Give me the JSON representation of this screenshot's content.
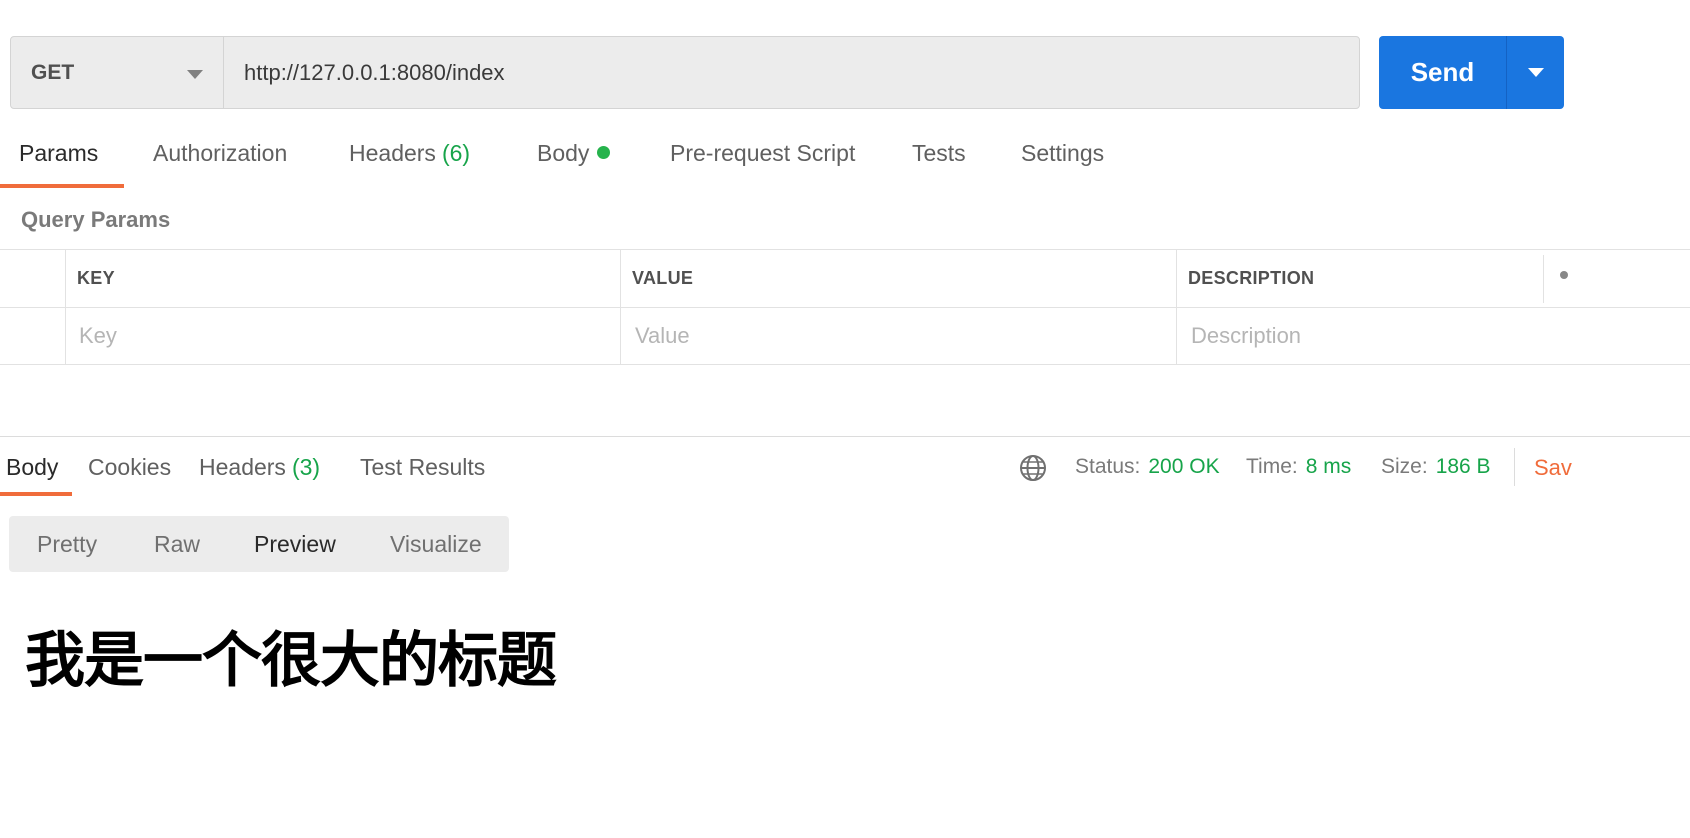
{
  "request": {
    "method": "GET",
    "url": "http://127.0.0.1:8080/index",
    "send_label": "Send"
  },
  "request_tabs": {
    "params": "Params",
    "authorization": "Authorization",
    "headers": "Headers",
    "headers_count": "(6)",
    "body": "Body",
    "pre_request_script": "Pre-request Script",
    "tests": "Tests",
    "settings": "Settings"
  },
  "query_params": {
    "title": "Query Params",
    "columns": {
      "key": "KEY",
      "value": "VALUE",
      "description": "DESCRIPTION"
    },
    "placeholders": {
      "key": "Key",
      "value": "Value",
      "description": "Description"
    }
  },
  "response_tabs": {
    "body": "Body",
    "cookies": "Cookies",
    "headers": "Headers",
    "headers_count": "(3)",
    "test_results": "Test Results"
  },
  "response_meta": {
    "status_label": "Status:",
    "status_value": "200 OK",
    "time_label": "Time:",
    "time_value": "8 ms",
    "size_label": "Size:",
    "size_value": "186 B",
    "save_label": "Sav"
  },
  "format_options": {
    "pretty": "Pretty",
    "raw": "Raw",
    "preview": "Preview",
    "visualize": "Visualize",
    "selected": "Preview"
  },
  "preview": {
    "heading": "我是一个很大的标题"
  },
  "colors": {
    "accent": "#f06c3b",
    "send": "#1a76e0",
    "success": "#17a44a"
  }
}
